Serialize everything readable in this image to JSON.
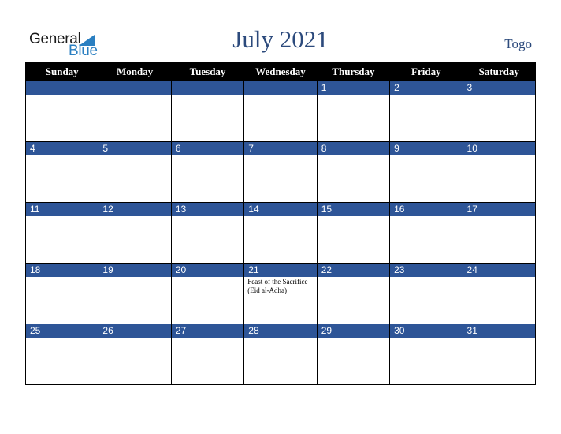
{
  "logo": {
    "line1": "General",
    "line2": "Blue"
  },
  "title": "July 2021",
  "country": "Togo",
  "weekdays": [
    "Sunday",
    "Monday",
    "Tuesday",
    "Wednesday",
    "Thursday",
    "Friday",
    "Saturday"
  ],
  "weeks": [
    [
      {
        "day": ""
      },
      {
        "day": ""
      },
      {
        "day": ""
      },
      {
        "day": ""
      },
      {
        "day": "1"
      },
      {
        "day": "2"
      },
      {
        "day": "3"
      }
    ],
    [
      {
        "day": "4"
      },
      {
        "day": "5"
      },
      {
        "day": "6"
      },
      {
        "day": "7"
      },
      {
        "day": "8"
      },
      {
        "day": "9"
      },
      {
        "day": "10"
      }
    ],
    [
      {
        "day": "11"
      },
      {
        "day": "12"
      },
      {
        "day": "13"
      },
      {
        "day": "14"
      },
      {
        "day": "15"
      },
      {
        "day": "16"
      },
      {
        "day": "17"
      }
    ],
    [
      {
        "day": "18"
      },
      {
        "day": "19"
      },
      {
        "day": "20"
      },
      {
        "day": "21",
        "event": "Feast of the Sacrifice (Eid al-Adha)"
      },
      {
        "day": "22"
      },
      {
        "day": "23"
      },
      {
        "day": "24"
      }
    ],
    [
      {
        "day": "25"
      },
      {
        "day": "26"
      },
      {
        "day": "27"
      },
      {
        "day": "28"
      },
      {
        "day": "29"
      },
      {
        "day": "30"
      },
      {
        "day": "31"
      }
    ]
  ],
  "colors": {
    "header_bg": "#000000",
    "day_bar": "#2e5597",
    "title": "#2c4a7c",
    "logo_blue": "#2a7fc1"
  }
}
